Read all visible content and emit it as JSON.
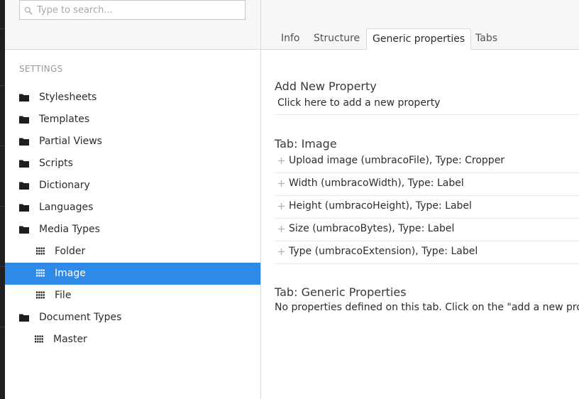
{
  "search": {
    "placeholder": "Type to search..."
  },
  "tree": {
    "section_title": "SETTINGS",
    "items": [
      {
        "label": "Stylesheets",
        "icon": "folder-icon"
      },
      {
        "label": "Templates",
        "icon": "folder-icon"
      },
      {
        "label": "Partial Views",
        "icon": "folder-icon"
      },
      {
        "label": "Scripts",
        "icon": "folder-icon"
      },
      {
        "label": "Dictionary",
        "icon": "folder-icon"
      },
      {
        "label": "Languages",
        "icon": "folder-icon"
      },
      {
        "label": "Media Types",
        "icon": "folder-icon"
      },
      {
        "label": "Folder",
        "icon": "grid-icon"
      },
      {
        "label": "Image",
        "icon": "grid-icon",
        "selected": true
      },
      {
        "label": "File",
        "icon": "grid-icon"
      },
      {
        "label": "Document Types",
        "icon": "folder-icon"
      },
      {
        "label": "Master",
        "icon": "grid-icon"
      }
    ]
  },
  "tabs": [
    {
      "label": "Info"
    },
    {
      "label": "Structure"
    },
    {
      "label": "Generic properties",
      "active": true
    },
    {
      "label": "Tabs"
    }
  ],
  "main": {
    "add_heading": "Add New Property",
    "add_link": "Click here to add a new property",
    "tab_image_heading": "Tab: Image",
    "properties": [
      "Upload image (umbracoFile), Type: Cropper",
      "Width (umbracoWidth), Type: Label",
      "Height (umbracoHeight), Type: Label",
      "Size (umbracoBytes), Type: Label",
      "Type (umbracoExtension), Type: Label"
    ],
    "generic_heading": "Tab: Generic Properties",
    "generic_note": "No properties defined on this tab. Click on the \"add a new property\" link at the top to create a new property."
  },
  "colors": {
    "selected_bg": "#2e8ae6",
    "panel_bg": "#f7f7f7",
    "border": "#d9d9d9"
  }
}
